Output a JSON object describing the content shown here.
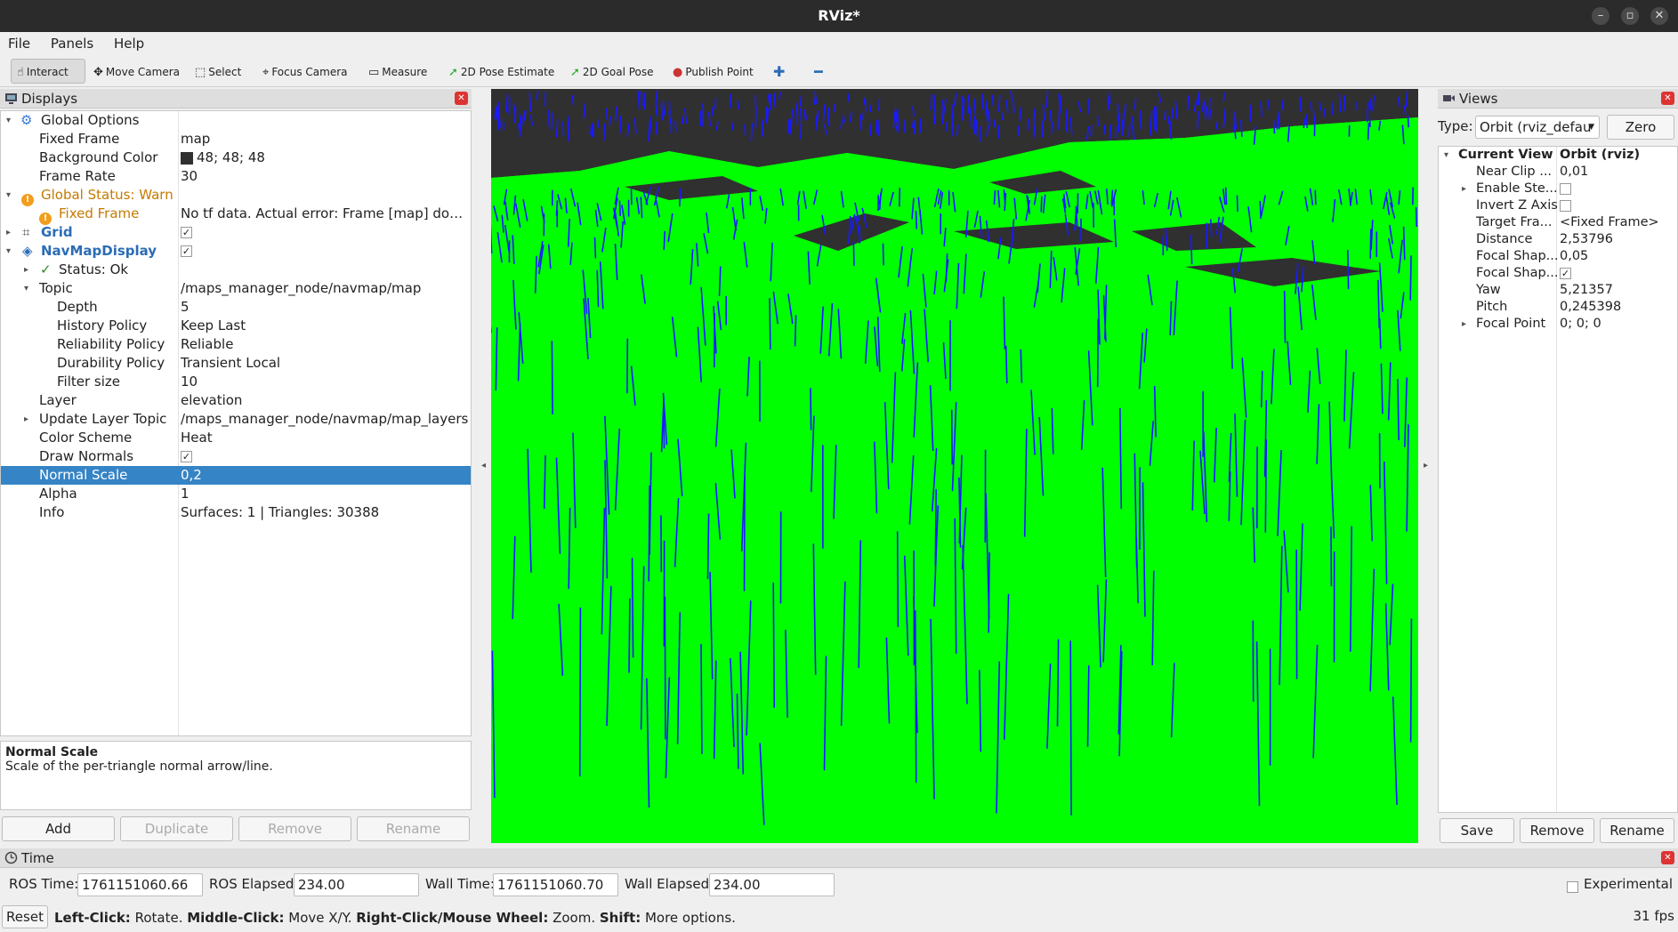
{
  "window": {
    "title": "RViz*"
  },
  "menu": [
    "File",
    "Panels",
    "Help"
  ],
  "toolbar": {
    "interact": "Interact",
    "move_camera": "Move Camera",
    "select": "Select",
    "focus_camera": "Focus Camera",
    "measure": "Measure",
    "pose_estimate": "2D Pose Estimate",
    "goal_pose": "2D Goal Pose",
    "publish_point": "Publish Point"
  },
  "displays": {
    "title": "Displays",
    "rows": [
      {
        "key": "Global Options",
        "value": ""
      },
      {
        "key": "Fixed Frame",
        "value": "map"
      },
      {
        "key": "Background Color",
        "value": "48; 48; 48"
      },
      {
        "key": "Frame Rate",
        "value": "30"
      },
      {
        "key": "Global Status: Warn",
        "value": ""
      },
      {
        "key": "Fixed Frame",
        "value": "No tf data.  Actual error: Frame [map] does no..."
      },
      {
        "key": "Grid",
        "value": ""
      },
      {
        "key": "NavMapDisplay",
        "value": ""
      },
      {
        "key": "Status: Ok",
        "value": ""
      },
      {
        "key": "Topic",
        "value": "/maps_manager_node/navmap/map"
      },
      {
        "key": "Depth",
        "value": "5"
      },
      {
        "key": "History Policy",
        "value": "Keep Last"
      },
      {
        "key": "Reliability Policy",
        "value": "Reliable"
      },
      {
        "key": "Durability Policy",
        "value": "Transient Local"
      },
      {
        "key": "Filter size",
        "value": "10"
      },
      {
        "key": "Layer",
        "value": "elevation"
      },
      {
        "key": "Update Layer Topic",
        "value": "/maps_manager_node/navmap/map_layers"
      },
      {
        "key": "Color Scheme",
        "value": "Heat"
      },
      {
        "key": "Draw Normals",
        "value": ""
      },
      {
        "key": "Normal Scale",
        "value": "0,2"
      },
      {
        "key": "Alpha",
        "value": "1"
      },
      {
        "key": "Info",
        "value": "Surfaces: 1 | Triangles: 30388"
      }
    ],
    "description_title": "Normal Scale",
    "description_text": "Scale of the per-triangle normal arrow/line.",
    "buttons": {
      "add": "Add",
      "duplicate": "Duplicate",
      "remove": "Remove",
      "rename": "Rename"
    }
  },
  "views": {
    "title": "Views",
    "type_label": "Type:",
    "type_value": "Orbit (rviz_defau",
    "zero": "Zero",
    "header_key": "Current View",
    "header_value": "Orbit (rviz)",
    "rows": [
      {
        "key": "Near Clip ...",
        "value": "0,01"
      },
      {
        "key": "Enable Ste...",
        "value": ""
      },
      {
        "key": "Invert Z Axis",
        "value": ""
      },
      {
        "key": "Target Fra...",
        "value": "<Fixed Frame>"
      },
      {
        "key": "Distance",
        "value": "2,53796"
      },
      {
        "key": "Focal Shap...",
        "value": "0,05"
      },
      {
        "key": "Focal Shap...",
        "value": ""
      },
      {
        "key": "Yaw",
        "value": "5,21357"
      },
      {
        "key": "Pitch",
        "value": "0,245398"
      },
      {
        "key": "Focal Point",
        "value": "0; 0; 0"
      }
    ],
    "buttons": {
      "save": "Save",
      "remove": "Remove",
      "rename": "Rename"
    }
  },
  "time": {
    "title": "Time",
    "ros_time_label": "ROS Time:",
    "ros_time": "1761151060.66",
    "ros_elapsed_label": "ROS Elapsed:",
    "ros_elapsed": "234.00",
    "wall_time_label": "Wall Time:",
    "wall_time": "1761151060.70",
    "wall_elapsed_label": "Wall Elapsed:",
    "wall_elapsed": "234.00",
    "experimental": "Experimental"
  },
  "status": {
    "reset": "Reset",
    "hint_1_bold": "Left-Click:",
    "hint_1": " Rotate. ",
    "hint_2_bold": "Middle-Click:",
    "hint_2": " Move X/Y. ",
    "hint_3_bold": "Right-Click/Mouse Wheel:",
    "hint_3": " Zoom. ",
    "hint_4_bold": "Shift:",
    "hint_4": " More options.",
    "fps": "31 fps"
  },
  "colors": {
    "surface": "#00ff00",
    "normals": "#1a1aff",
    "background": "#303030",
    "selection": "#3584c6"
  }
}
